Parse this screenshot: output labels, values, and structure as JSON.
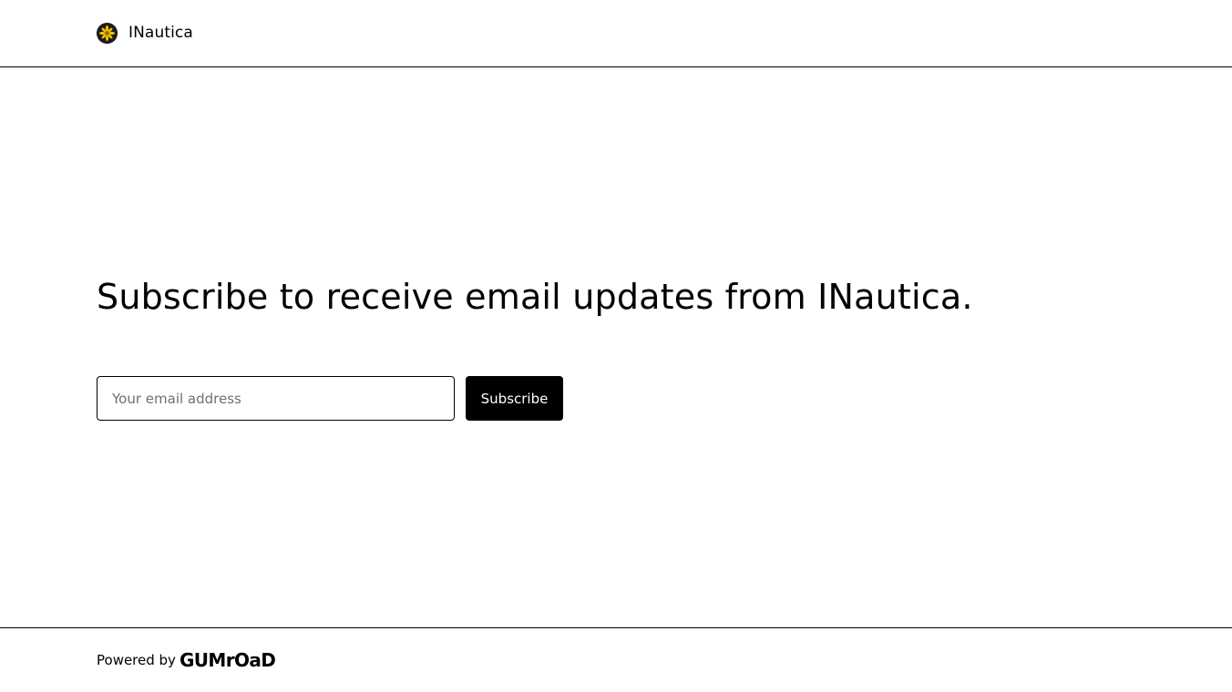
{
  "header": {
    "brand_name": "INautica",
    "avatar_icon": "flower-logo-icon"
  },
  "main": {
    "headline": "Subscribe to receive email updates from INautica.",
    "email_placeholder": "Your email address",
    "email_value": "",
    "subscribe_label": "Subscribe"
  },
  "footer": {
    "powered_by": "Powered by",
    "gumroad_logo_text": "GUMrOaD"
  },
  "colors": {
    "text": "#000000",
    "background": "#ffffff",
    "button_bg": "#000000",
    "button_text": "#ffffff",
    "placeholder": "#707070",
    "logo_flower": "#f2c300"
  }
}
